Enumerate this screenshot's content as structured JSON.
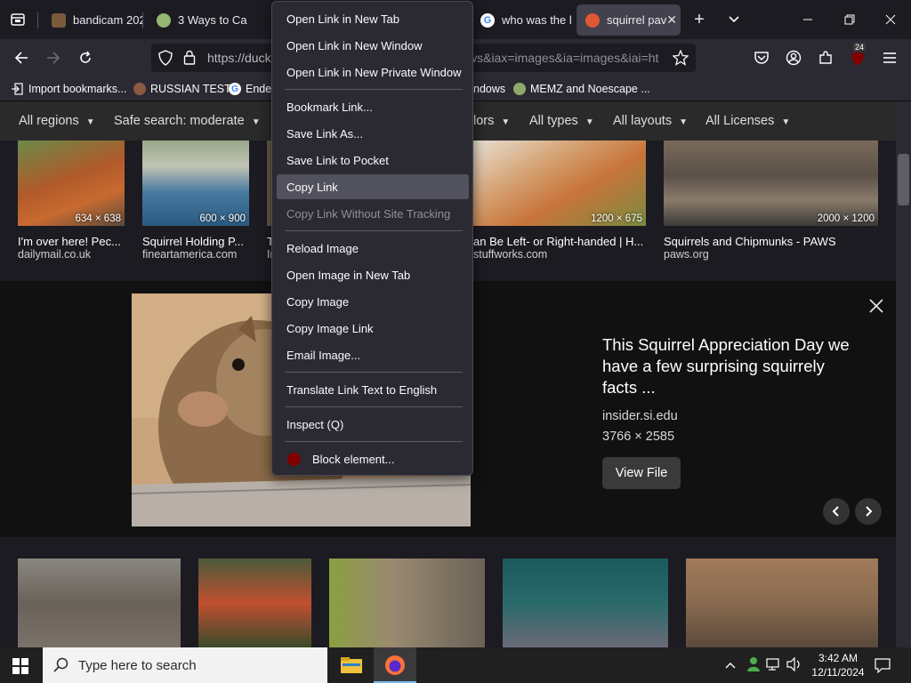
{
  "tabs": [
    {
      "title": "bandicam 202",
      "active": false
    },
    {
      "title": "3 Ways to Cal",
      "active": false
    },
    {
      "title": "who was the l",
      "active": false
    },
    {
      "title": "squirrel pav",
      "active": true
    }
  ],
  "nav": {
    "url_visible": "https://duck",
    "url_tail": "ws&iax=images&ia=images&iai=ht"
  },
  "extensions": {
    "ublock_badge": "24"
  },
  "bookmarks": [
    {
      "label": "Import bookmarks..."
    },
    {
      "label": "RUSSIAN TEST"
    },
    {
      "label": "Ende"
    },
    {
      "label": "ndows"
    },
    {
      "label": "MEMZ and Noescape ..."
    }
  ],
  "filters": [
    {
      "label": "All regions"
    },
    {
      "label": "Safe search: moderate"
    },
    {
      "label": "lors"
    },
    {
      "label": "All types"
    },
    {
      "label": "All layouts"
    },
    {
      "label": "All Licenses"
    }
  ],
  "results_top": [
    {
      "dims": "634 × 638",
      "title": "I'm over here! Pec...",
      "source": "dailymail.co.uk"
    },
    {
      "dims": "600 × 900",
      "title": "Squirrel Holding P...",
      "source": "fineartamerica.com"
    },
    {
      "dims": "",
      "title": "T",
      "source": "In"
    },
    {
      "dims": "1200 × 675",
      "title": "an Be Left- or Right-handed | H...",
      "source": "stuffworks.com"
    },
    {
      "dims": "2000 × 1200",
      "title": "Squirrels and Chipmunks - PAWS",
      "source": "paws.org"
    }
  ],
  "detail": {
    "title": "This Squirrel Appreciation Day we have a few surprising squirrely facts ...",
    "source": "insider.si.edu",
    "dims": "3766 × 2585",
    "view_file": "View File"
  },
  "context_menu": [
    {
      "label": "Open Link in New Tab",
      "state": "normal"
    },
    {
      "label": "Open Link in New Window",
      "state": "normal"
    },
    {
      "label": "Open Link in New Private Window",
      "state": "normal"
    },
    {
      "label": "Bookmark Link...",
      "state": "normal"
    },
    {
      "label": "Save Link As...",
      "state": "normal"
    },
    {
      "label": "Save Link to Pocket",
      "state": "normal"
    },
    {
      "label": "Copy Link",
      "state": "hover"
    },
    {
      "label": "Copy Link Without Site Tracking",
      "state": "disabled"
    },
    {
      "label": "Reload Image",
      "state": "normal"
    },
    {
      "label": "Open Image in New Tab",
      "state": "normal"
    },
    {
      "label": "Copy Image",
      "state": "normal"
    },
    {
      "label": "Copy Image Link",
      "state": "normal"
    },
    {
      "label": "Email Image...",
      "state": "normal"
    },
    {
      "label": "Translate Link Text to English",
      "state": "normal"
    },
    {
      "label": "Inspect (Q)",
      "state": "normal"
    },
    {
      "label": "Block element...",
      "state": "normal"
    }
  ],
  "taskbar": {
    "search_placeholder": "Type here to search",
    "time": "3:42 AM",
    "date": "12/11/2024"
  }
}
